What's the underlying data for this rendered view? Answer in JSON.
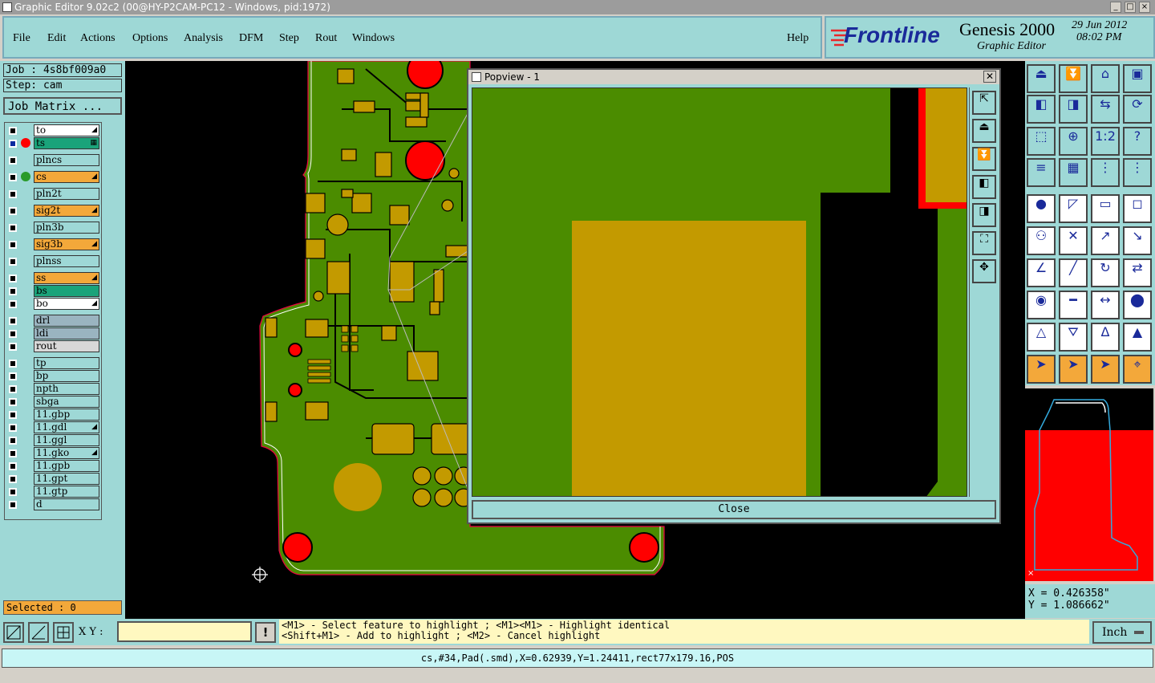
{
  "window": {
    "title": "Graphic Editor 9.02c2 (00@HY-P2CAM-PC12 - Windows, pid:1972)"
  },
  "menu": [
    "File",
    "Edit",
    "Actions",
    "Options",
    "Analysis",
    "DFM",
    "Step",
    "Rout",
    "Windows"
  ],
  "help": "Help",
  "brand": {
    "logo": "Frontline",
    "product": "Genesis 2000",
    "subtitle": "Graphic Editor",
    "date": "29 Jun 2012",
    "time": "08:02 PM"
  },
  "job": {
    "job": "Job : 4s8bf009a0",
    "step": "Step: cam",
    "matrix_btn": "Job Matrix ..."
  },
  "layers": [
    {
      "name": "to",
      "color": "#ffffff",
      "mark": "◢"
    },
    {
      "name": "ts",
      "color": "#1aa37a",
      "mark": "▦",
      "active": true
    },
    {
      "name": "plncs",
      "color": "#9ed8d6"
    },
    {
      "name": "cs",
      "color": "#f3a83a",
      "mark": "◢",
      "dot": "green"
    },
    {
      "name": "pln2t",
      "color": "#9ed8d6"
    },
    {
      "name": "sig2t",
      "color": "#f3a83a",
      "mark": "◢"
    },
    {
      "name": "pln3b",
      "color": "#9ed8d6"
    },
    {
      "name": "sig3b",
      "color": "#f3a83a",
      "mark": "◢"
    },
    {
      "name": "plnss",
      "color": "#9ed8d6"
    },
    {
      "name": "ss",
      "color": "#f3a83a",
      "mark": "◢"
    },
    {
      "name": "bs",
      "color": "#1aa37a"
    },
    {
      "name": "bo",
      "color": "#ffffff",
      "mark": "◢"
    },
    {
      "name": "drl",
      "color": "#9ab4c0"
    },
    {
      "name": "ldi",
      "color": "#9ab4c0"
    },
    {
      "name": "rout",
      "color": "#d8d8d8"
    },
    {
      "name": "tp",
      "color": "#9ed8d6"
    },
    {
      "name": "bp",
      "color": "#9ed8d6"
    },
    {
      "name": "npth",
      "color": "#9ed8d6"
    },
    {
      "name": "sbga",
      "color": "#9ed8d6"
    },
    {
      "name": "11.gbp",
      "color": "#9ed8d6"
    },
    {
      "name": "11.gdl",
      "color": "#9ed8d6",
      "mark": "◢"
    },
    {
      "name": "11.ggl",
      "color": "#9ed8d6"
    },
    {
      "name": "11.gko",
      "color": "#9ed8d6",
      "mark": "◢"
    },
    {
      "name": "11.gpb",
      "color": "#9ed8d6"
    },
    {
      "name": "11.gpt",
      "color": "#9ed8d6"
    },
    {
      "name": "11.gtp",
      "color": "#9ed8d6"
    },
    {
      "name": "d",
      "color": "#9ed8d6"
    }
  ],
  "selected": "Selected : 0",
  "popview": {
    "title": "Popview - 1",
    "close": "Close"
  },
  "coords": {
    "x": "X = 0.426358\"",
    "y": "Y = 1.086662\""
  },
  "bottom": {
    "xy_label": "X Y :",
    "xy_value": "",
    "hint1": "<M1> - Select feature to highlight ; <M1><M1> - Highlight identical",
    "hint2": "<Shift+M1> - Add to highlight ; <M2> - Cancel highlight",
    "units": "Inch"
  },
  "status": "cs,#34,Pad(.smd),X=0.62939,Y=1.24411,rect77x179.16,POS",
  "colors": {
    "board": "#4b8c00",
    "copper": "#c39a00",
    "pad_red": "#ff0000",
    "panel": "#9ed8d6",
    "select": "#f3a83a"
  }
}
